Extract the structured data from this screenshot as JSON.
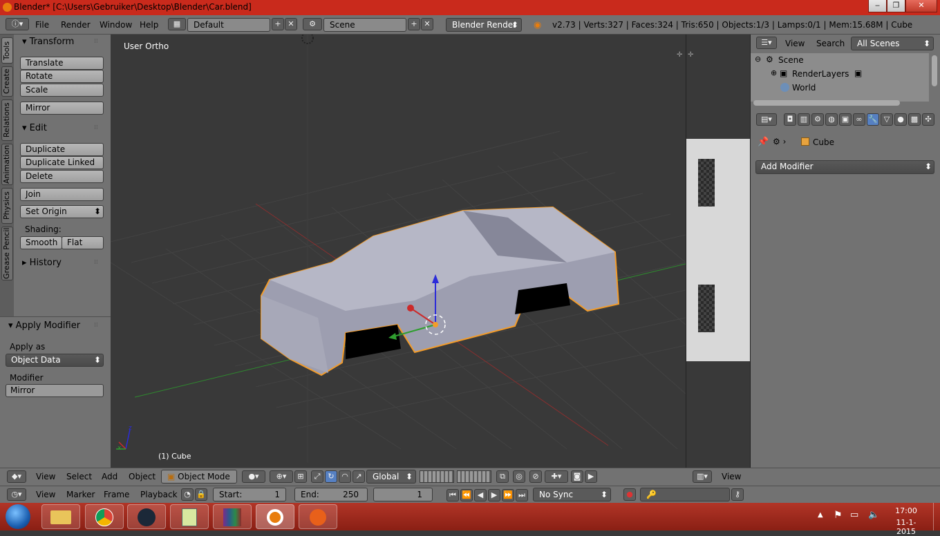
{
  "window": {
    "title": "Blender* [C:\\Users\\Gebruiker\\Desktop\\Blender\\Car.blend]",
    "min": "‒",
    "max": "❐",
    "close": "✕"
  },
  "menubar": {
    "menus": [
      "File",
      "Render",
      "Window",
      "Help"
    ],
    "layout": "Default",
    "scene": "Scene",
    "engine": "Blender Render",
    "stats": "v2.73 | Verts:327 | Faces:324 | Tris:650 | Objects:1/3 | Lamps:0/1 | Mem:15.68M | Cube"
  },
  "toolshelf": {
    "tabs": [
      "Tools",
      "Create",
      "Relations",
      "Animation",
      "Physics",
      "Grease Pencil"
    ],
    "transform": {
      "title": "Transform",
      "buttons": [
        "Translate",
        "Rotate",
        "Scale"
      ],
      "mirror": "Mirror"
    },
    "edit": {
      "title": "Edit",
      "buttons": [
        "Duplicate",
        "Duplicate Linked",
        "Delete"
      ],
      "join": "Join",
      "set_origin": "Set Origin",
      "shading_label": "Shading:",
      "smooth": "Smooth",
      "flat": "Flat"
    },
    "history": {
      "title": "History"
    }
  },
  "operator": {
    "title": "Apply Modifier",
    "apply_as_label": "Apply as",
    "apply_as_value": "Object Data",
    "modifier_label": "Modifier",
    "modifier_value": "Mirror"
  },
  "viewport": {
    "view_label": "User Ortho",
    "object_label": "(1) Cube",
    "axis_x": "x",
    "axis_z": "z"
  },
  "outliner": {
    "view": "View",
    "search": "Search",
    "scenes": "All Scenes",
    "items": [
      "Scene",
      "RenderLayers",
      "World"
    ]
  },
  "properties": {
    "object": "Cube",
    "add_modifier": "Add Modifier"
  },
  "header3d": {
    "menus": [
      "View",
      "Select",
      "Add",
      "Object"
    ],
    "mode": "Object Mode",
    "orientation": "Global",
    "uv_view": "View"
  },
  "timeline": {
    "menus": [
      "View",
      "Marker",
      "Frame",
      "Playback"
    ],
    "start_label": "Start:",
    "start": "1",
    "end_label": "End:",
    "end": "250",
    "current": "1",
    "sync": "No Sync"
  },
  "taskbar": {
    "time": "17:00",
    "date": "11-1-2015"
  },
  "colors": {
    "titlebar": "#c92a1c",
    "panel": "#727272",
    "viewport": "#393939",
    "selection": "#f39c2a",
    "taskbar": "#a12b1f"
  }
}
